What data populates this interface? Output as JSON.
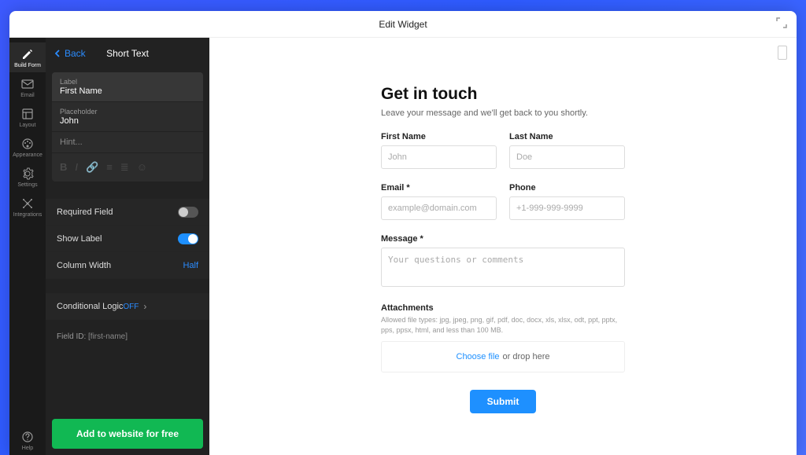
{
  "window": {
    "title": "Edit Widget"
  },
  "iconbar": {
    "items": [
      {
        "label": "Build Form"
      },
      {
        "label": "Email"
      },
      {
        "label": "Layout"
      },
      {
        "label": "Appearance"
      },
      {
        "label": "Settings"
      },
      {
        "label": "Integrations"
      }
    ],
    "help": "Help"
  },
  "panel": {
    "back": "Back",
    "title": "Short Text",
    "field_label_caption": "Label",
    "field_label_value": "First Name",
    "placeholder_caption": "Placeholder",
    "placeholder_value": "John",
    "hint_caption": "Hint...",
    "opt_required": "Required Field",
    "opt_showlabel": "Show Label",
    "opt_colwidth": "Column Width",
    "colwidth_value": "Half",
    "logic_label": "Conditional Logic",
    "logic_value": "OFF",
    "fieldid_label": "Field ID:",
    "fieldid_value": "[first-name]",
    "add_btn": "Add to website for free"
  },
  "form": {
    "title": "Get in touch",
    "subtitle": "Leave your message and we'll get back to you shortly.",
    "firstname_label": "First Name",
    "firstname_ph": "John",
    "lastname_label": "Last Name",
    "lastname_ph": "Doe",
    "email_label": "Email *",
    "email_ph": "example@domain.com",
    "phone_label": "Phone",
    "phone_ph": "+1-999-999-9999",
    "message_label": "Message *",
    "message_ph": "Your questions or comments",
    "att_label": "Attachments",
    "att_sub": "Allowed file types: jpg, jpeg, png, gif, pdf, doc, docx, xls, xlsx, odt, ppt, pptx, pps, ppsx, html, and less than 100 MB.",
    "choose_file": "Choose file",
    "drop_here": "or drop here",
    "submit": "Submit"
  }
}
